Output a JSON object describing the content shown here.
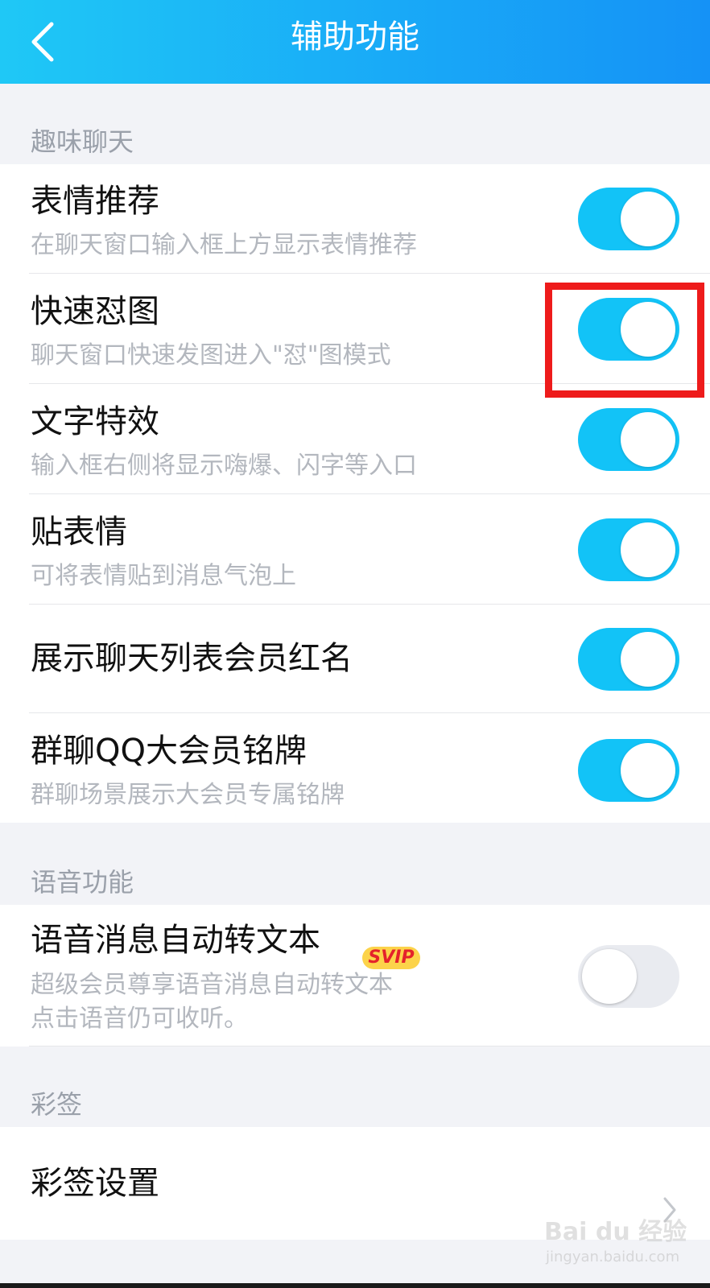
{
  "header": {
    "title": "辅助功能"
  },
  "sections": {
    "fun_chat": "趣味聊天",
    "voice": "语音功能",
    "caiqian": "彩签"
  },
  "rows": [
    {
      "title": "表情推荐",
      "subtitle": "在聊天窗口输入框上方显示表情推荐",
      "toggle_on": true
    },
    {
      "title": "快速怼图",
      "subtitle": "聊天窗口快速发图进入\"怼\"图模式",
      "toggle_on": true
    },
    {
      "title": "文字特效",
      "subtitle": "输入框右侧将显示嗨爆、闪字等入口",
      "toggle_on": true
    },
    {
      "title": "贴表情",
      "subtitle": "可将表情贴到消息气泡上",
      "toggle_on": true
    },
    {
      "title": "展示聊天列表会员红名",
      "toggle_on": true
    },
    {
      "title": "群聊QQ大会员铭牌",
      "subtitle": "群聊场景展示大会员专属铭牌",
      "toggle_on": true
    }
  ],
  "voice_row": {
    "title": "语音消息自动转文本",
    "badge": "SVIP",
    "subtitle_line1": "超级会员尊享语音消息自动转文本",
    "subtitle_line2": "点击语音仍可收听。",
    "toggle_on": false
  },
  "caiqian_row": {
    "title": "彩签设置"
  },
  "watermark": {
    "brand": "Bai du 经验",
    "url": "jingyan.baidu.com"
  },
  "colors": {
    "accent": "#12c3f7",
    "header_start": "#1fc8f6",
    "header_end": "#1592f6",
    "highlight": "#ee1b1b",
    "badge": "#fcd34a"
  }
}
